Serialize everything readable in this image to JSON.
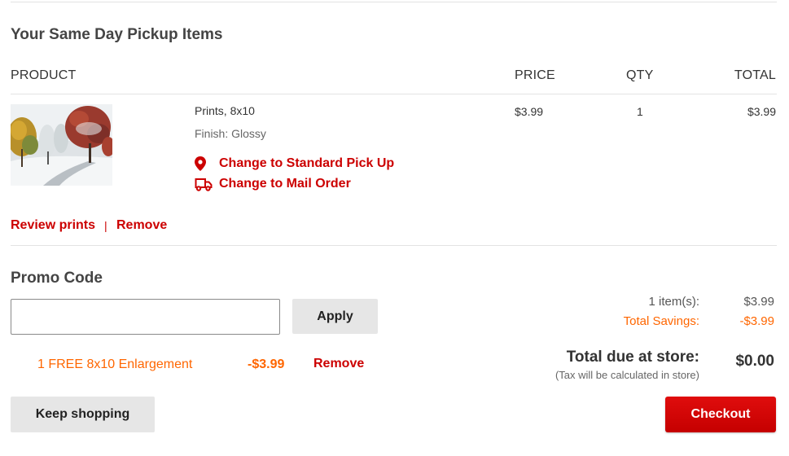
{
  "section": {
    "title": "Your Same Day Pickup Items"
  },
  "table": {
    "headers": {
      "product": "PRODUCT",
      "price": "PRICE",
      "qty": "QTY",
      "total": "TOTAL"
    },
    "items": [
      {
        "name": "Prints, 8x10",
        "finish": "Finish: Glossy",
        "price": "$3.99",
        "qty": "1",
        "total": "$3.99",
        "thumbnail_icon": "snowy-trees-photo",
        "actions": {
          "standard_pickup": "Change to Standard Pick Up",
          "standard_pickup_icon": "map-pin-icon",
          "mail_order": "Change to Mail Order",
          "mail_order_icon": "truck-icon"
        }
      }
    ],
    "links": {
      "review": "Review prints",
      "separator": "|",
      "remove": "Remove"
    }
  },
  "promo": {
    "title": "Promo Code",
    "input_value": "",
    "input_placeholder": "",
    "apply_label": "Apply",
    "applied": {
      "name": "1 FREE 8x10 Enlargement",
      "amount": "-$3.99",
      "remove_label": "Remove"
    }
  },
  "summary": {
    "items_label": "1 item(s):",
    "items_value": "$3.99",
    "savings_label": "Total Savings:",
    "savings_value": "-$3.99",
    "due_label": "Total due at store:",
    "due_value": "$0.00",
    "tax_note": "(Tax will be calculated in store)"
  },
  "buttons": {
    "keep_shopping": "Keep shopping",
    "checkout": "Checkout"
  },
  "colors": {
    "accent_red": "#cc0000",
    "savings_orange": "#ff6600",
    "checkout_red": "#d90707",
    "button_gray": "#e6e6e6"
  }
}
